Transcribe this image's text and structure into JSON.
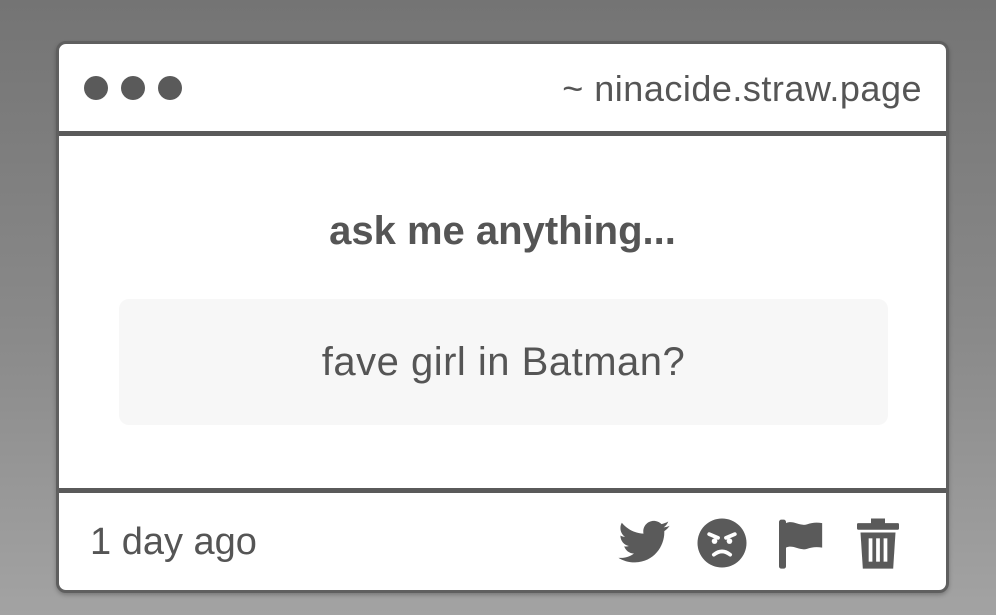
{
  "window": {
    "url": "~ ninacide.straw.page"
  },
  "main": {
    "heading": "ask me anything...",
    "question": "fave girl in Batman?"
  },
  "footer": {
    "timestamp": "1 day ago",
    "actions": [
      {
        "icon": "twitter-icon"
      },
      {
        "icon": "angry-face-icon"
      },
      {
        "icon": "flag-icon"
      },
      {
        "icon": "trash-icon"
      }
    ]
  },
  "colors": {
    "accent": "#5a5a5a",
    "text": "#555555",
    "card_bg": "#ffffff",
    "question_bg": "#f7f7f7"
  }
}
